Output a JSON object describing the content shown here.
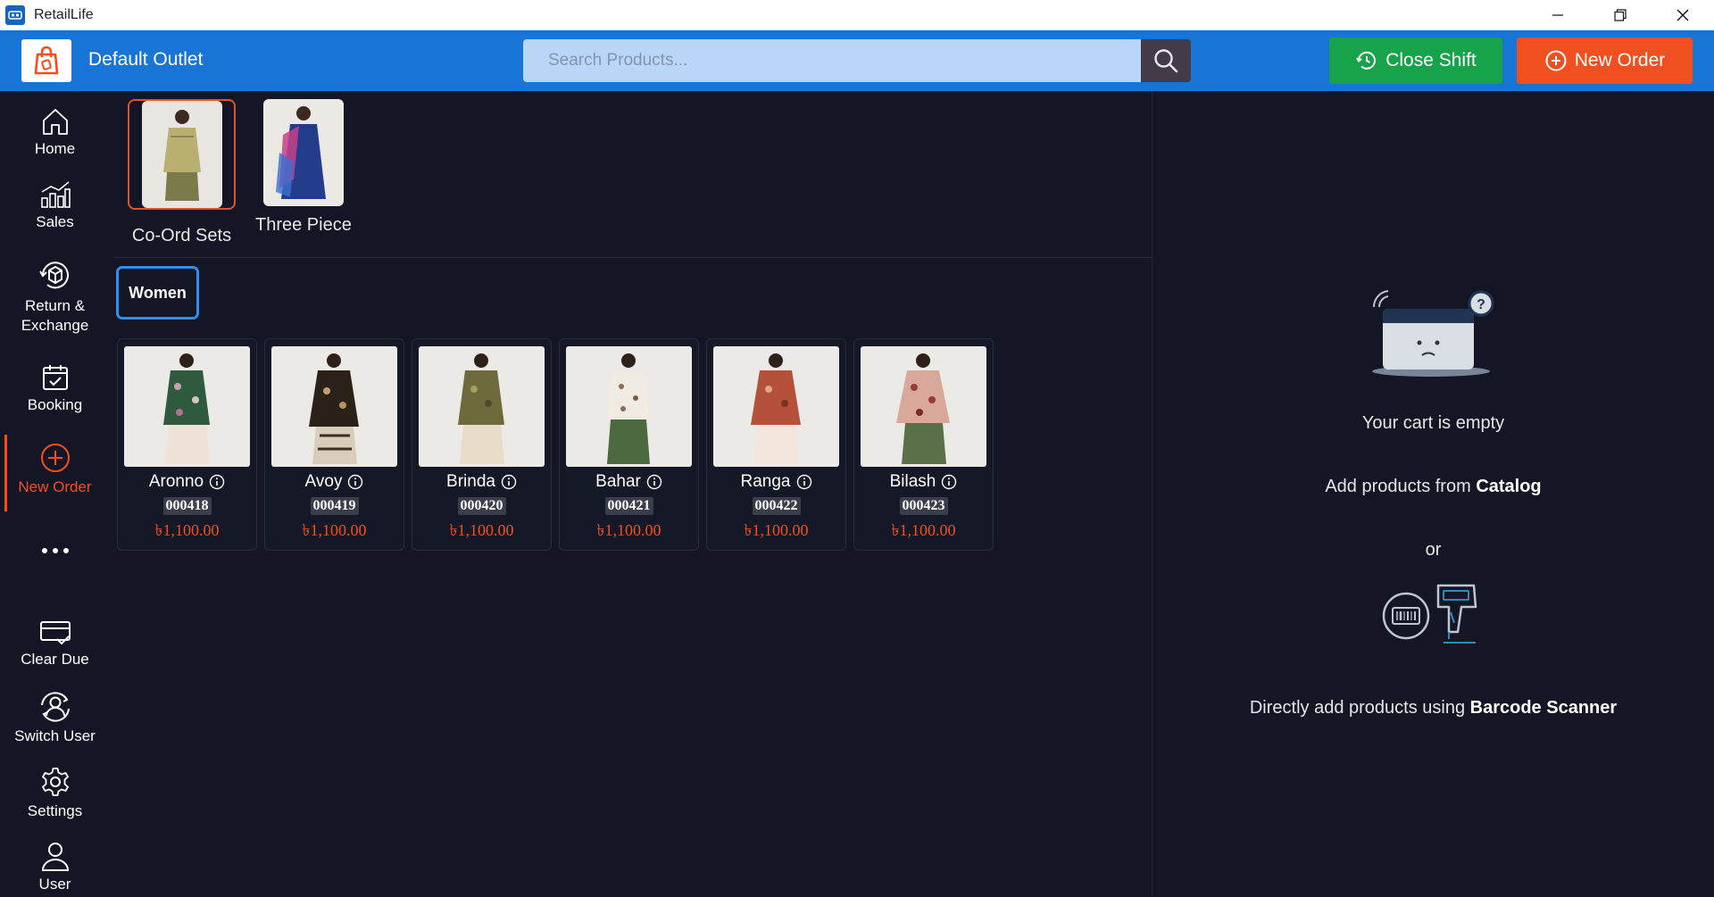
{
  "window": {
    "title": "RetailLife"
  },
  "header": {
    "outlet": "Default Outlet",
    "search_placeholder": "Search Products...",
    "close_shift_label": "Close Shift",
    "new_order_label": "New Order"
  },
  "sidebar": {
    "items": [
      {
        "label": "Home",
        "icon": "home-icon"
      },
      {
        "label": "Sales",
        "icon": "chart-icon"
      },
      {
        "label_line1": "Return &",
        "label_line2": "Exchange",
        "icon": "return-box-icon"
      },
      {
        "label": "Booking",
        "icon": "calendar-check-icon"
      },
      {
        "label": "New Order",
        "icon": "plus-circle-icon",
        "active": true
      },
      {
        "label": "...",
        "icon": "more-icon"
      },
      {
        "label": "Clear Due",
        "icon": "card-check-icon"
      },
      {
        "label": "Switch User",
        "icon": "switch-user-icon"
      },
      {
        "label": "Settings",
        "icon": "gear-icon"
      },
      {
        "label": "User",
        "icon": "user-icon"
      }
    ]
  },
  "categories": [
    {
      "label": "Co-Ord Sets",
      "selected": true
    },
    {
      "label": "Three Piece",
      "selected": false
    }
  ],
  "filters": {
    "tags": [
      "Women"
    ]
  },
  "products": [
    {
      "name": "Aronno",
      "sku": "000418",
      "price": "৳1,100.00"
    },
    {
      "name": "Avoy",
      "sku": "000419",
      "price": "৳1,100.00"
    },
    {
      "name": "Brinda",
      "sku": "000420",
      "price": "৳1,100.00"
    },
    {
      "name": "Bahar",
      "sku": "000421",
      "price": "৳1,100.00"
    },
    {
      "name": "Ranga",
      "sku": "000422",
      "price": "৳1,100.00"
    },
    {
      "name": "Bilash",
      "sku": "000423",
      "price": "৳1,100.00"
    }
  ],
  "cart": {
    "empty_text": "Your cart is empty",
    "catalog_prefix": "Add products from ",
    "catalog_bold": "Catalog",
    "or_text": "or",
    "scanner_prefix": "Directly add products using ",
    "scanner_bold": "Barcode Scanner"
  },
  "colors": {
    "brand_blue": "#1875d6",
    "success_green": "#16a34a",
    "accent_orange": "#f0501f",
    "background": "#141625"
  }
}
